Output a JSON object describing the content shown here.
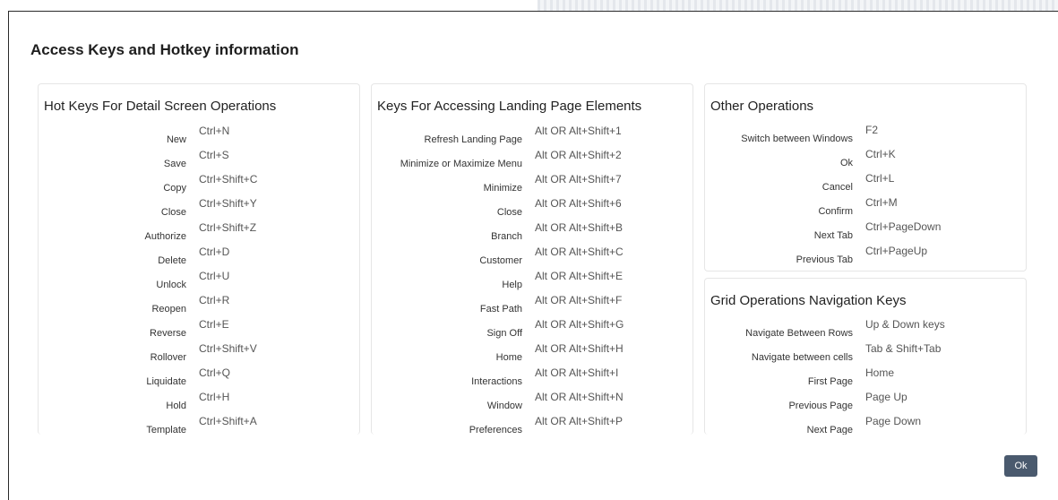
{
  "dialog": {
    "title": "Access Keys and Hotkey information",
    "ok_label": "Ok"
  },
  "panels": {
    "hot_keys": {
      "title": "Hot Keys For Detail Screen Operations",
      "rows": [
        {
          "label": "New",
          "value": "Ctrl+N"
        },
        {
          "label": "Save",
          "value": "Ctrl+S"
        },
        {
          "label": "Copy",
          "value": "Ctrl+Shift+C"
        },
        {
          "label": "Close",
          "value": "Ctrl+Shift+Y"
        },
        {
          "label": "Authorize",
          "value": "Ctrl+Shift+Z"
        },
        {
          "label": "Delete",
          "value": "Ctrl+D"
        },
        {
          "label": "Unlock",
          "value": "Ctrl+U"
        },
        {
          "label": "Reopen",
          "value": "Ctrl+R"
        },
        {
          "label": "Reverse",
          "value": "Ctrl+E"
        },
        {
          "label": "Rollover",
          "value": "Ctrl+Shift+V"
        },
        {
          "label": "Liquidate",
          "value": "Ctrl+Q"
        },
        {
          "label": "Hold",
          "value": "Ctrl+H"
        },
        {
          "label": "Template",
          "value": "Ctrl+Shift+A"
        }
      ]
    },
    "landing": {
      "title": "Keys For Accessing Landing Page Elements",
      "rows": [
        {
          "label": "Refresh Landing Page",
          "value": "Alt OR Alt+Shift+1"
        },
        {
          "label": "Minimize or Maximize Menu",
          "value": "Alt OR Alt+Shift+2"
        },
        {
          "label": "Minimize",
          "value": "Alt OR Alt+Shift+7"
        },
        {
          "label": "Close",
          "value": "Alt OR Alt+Shift+6"
        },
        {
          "label": "Branch",
          "value": "Alt OR Alt+Shift+B"
        },
        {
          "label": "Customer",
          "value": "Alt OR Alt+Shift+C"
        },
        {
          "label": "Help",
          "value": "Alt OR Alt+Shift+E"
        },
        {
          "label": "Fast Path",
          "value": "Alt OR Alt+Shift+F"
        },
        {
          "label": "Sign Off",
          "value": "Alt OR Alt+Shift+G"
        },
        {
          "label": "Home",
          "value": "Alt OR Alt+Shift+H"
        },
        {
          "label": "Interactions",
          "value": "Alt OR Alt+Shift+I"
        },
        {
          "label": "Window",
          "value": "Alt OR Alt+Shift+N"
        },
        {
          "label": "Preferences",
          "value": "Alt OR Alt+Shift+P"
        }
      ]
    },
    "other": {
      "title": "Other Operations",
      "rows": [
        {
          "label": "Switch between Windows",
          "value": "F2"
        },
        {
          "label": "Ok",
          "value": "Ctrl+K"
        },
        {
          "label": "Cancel",
          "value": "Ctrl+L"
        },
        {
          "label": "Confirm",
          "value": "Ctrl+M"
        },
        {
          "label": "Next Tab",
          "value": "Ctrl+PageDown"
        },
        {
          "label": "Previous Tab",
          "value": "Ctrl+PageUp"
        }
      ]
    },
    "grid": {
      "title": "Grid Operations Navigation Keys",
      "rows": [
        {
          "label": "Navigate Between Rows",
          "value": "Up & Down keys"
        },
        {
          "label": "Navigate between cells",
          "value": "Tab & Shift+Tab"
        },
        {
          "label": "First Page",
          "value": "Home"
        },
        {
          "label": "Previous Page",
          "value": "Page Up"
        },
        {
          "label": "Next Page",
          "value": "Page Down"
        }
      ]
    }
  }
}
